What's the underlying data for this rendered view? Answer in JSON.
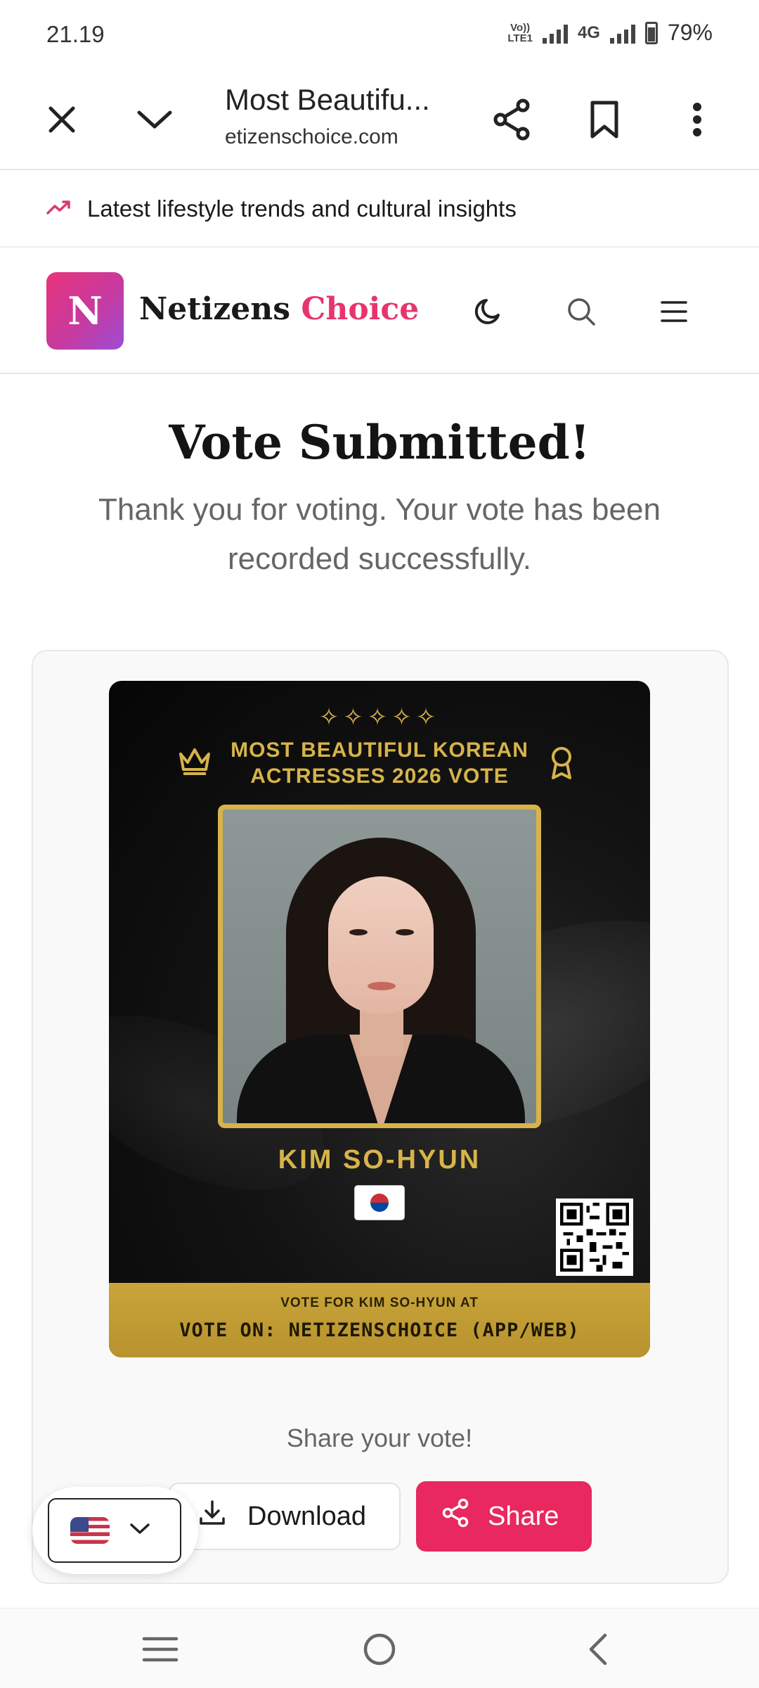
{
  "status": {
    "time": "21.19",
    "volte_top": "Vo))",
    "volte_bottom": "LTE1",
    "network": "4G",
    "battery": "79%"
  },
  "browser": {
    "title": "Most Beautifu...",
    "url": "etizenschoice.com"
  },
  "banner": {
    "text": "Latest lifestyle trends and cultural insights"
  },
  "site": {
    "logo_letter": "N",
    "brand_main": "Netizens",
    "brand_accent": "Choice",
    "accent_color": "#e8346d"
  },
  "page": {
    "title": "Vote Submitted!",
    "message": "Thank you for voting. Your vote has been recorded successfully."
  },
  "poster": {
    "sparkles": "✧✧✧✧✧",
    "title_line1": "MOST BEAUTIFUL KOREAN",
    "title_line2": "ACTRESSES 2026 VOTE",
    "name": "KIM SO-HYUN",
    "footer_small": "VOTE FOR KIM SO-HYUN AT",
    "footer_big": "VOTE ON: NETIZENSCHOICE (APP/WEB)",
    "gold_color": "#d7b34a"
  },
  "share": {
    "label": "Share your vote!",
    "download_label": "Download",
    "share_label": "Share",
    "share_color": "#e8285f"
  },
  "language": {
    "selected_icon": "us-flag-icon"
  }
}
